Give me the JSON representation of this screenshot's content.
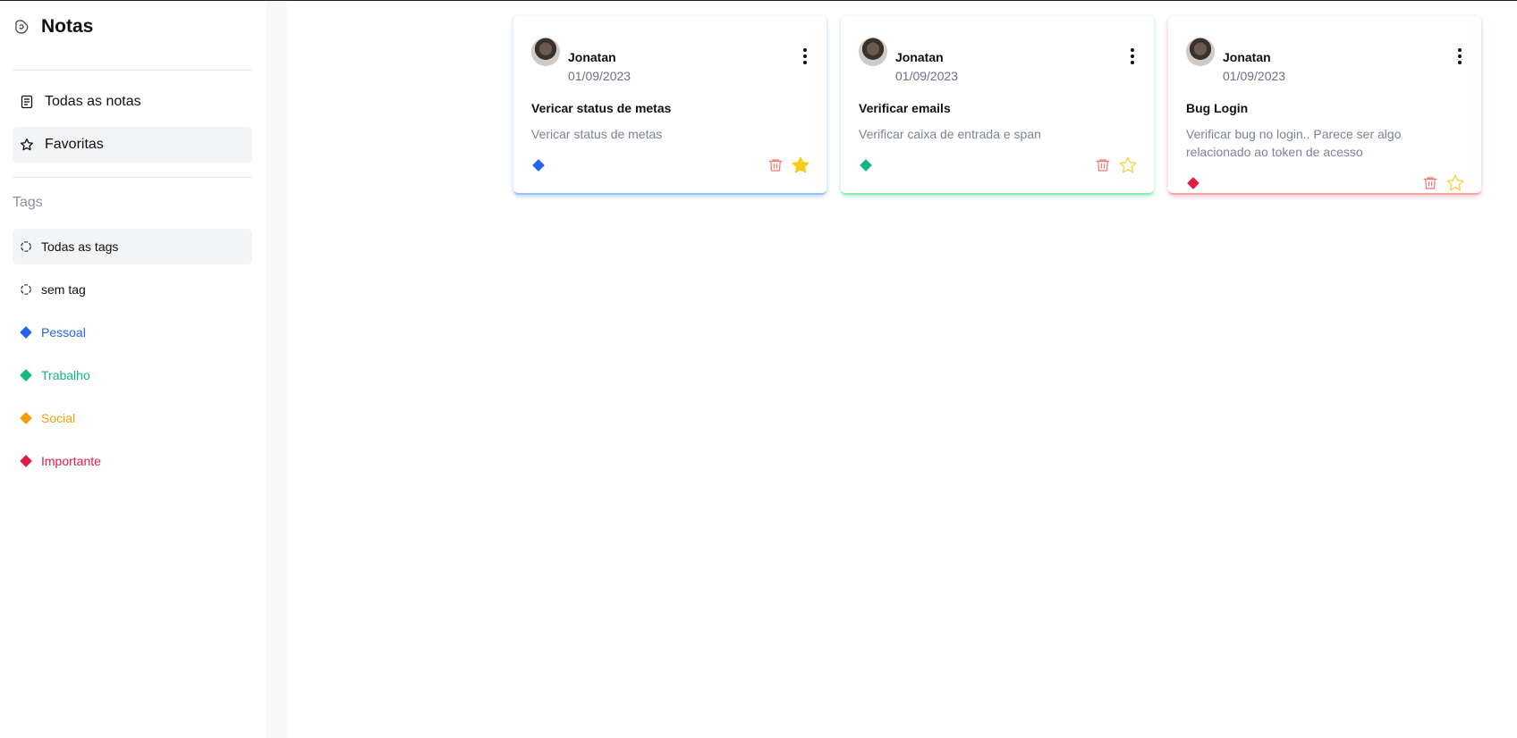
{
  "app": {
    "title": "Notas"
  },
  "nav": {
    "all_notes_label": "Todas as notas",
    "favorites_label": "Favoritas"
  },
  "tags": {
    "heading": "Tags",
    "items": [
      {
        "label": "Todas as tags",
        "color": "#111111",
        "active": true,
        "icon": "dashed-circle-icon"
      },
      {
        "label": "sem tag",
        "color": "#111111",
        "active": false,
        "icon": "dashed-circle-icon"
      },
      {
        "label": "Pessoal",
        "color": "#2563eb",
        "active": false,
        "icon": "diamond-icon"
      },
      {
        "label": "Trabalho",
        "color": "#10b981",
        "active": false,
        "icon": "diamond-icon"
      },
      {
        "label": "Social",
        "color": "#f59e0b",
        "active": false,
        "icon": "diamond-icon"
      },
      {
        "label": "Importante",
        "color": "#e11d48",
        "active": false,
        "icon": "diamond-icon"
      }
    ]
  },
  "notes": [
    {
      "author": "Jonatan",
      "date": "01/09/2023",
      "title": "Vericar status de metas",
      "description": "Vericar status de metas",
      "tag_color": "#2563eb",
      "accent_color": "#93c5fd",
      "favorite": true
    },
    {
      "author": "Jonatan",
      "date": "01/09/2023",
      "title": "Verificar emails",
      "description": "Verificar caixa de entrada e span",
      "tag_color": "#10b981",
      "accent_color": "#86efac",
      "favorite": false
    },
    {
      "author": "Jonatan",
      "date": "01/09/2023",
      "title": "Bug Login",
      "description": "Verificar bug no login.. Parece ser algo relacionado ao token de acesso",
      "tag_color": "#e11d48",
      "accent_color": "#fca5a5",
      "favorite": false
    }
  ],
  "colors": {
    "trash": "#f87171",
    "star_filled": "#facc15",
    "star_outline": "#fcd34d"
  }
}
